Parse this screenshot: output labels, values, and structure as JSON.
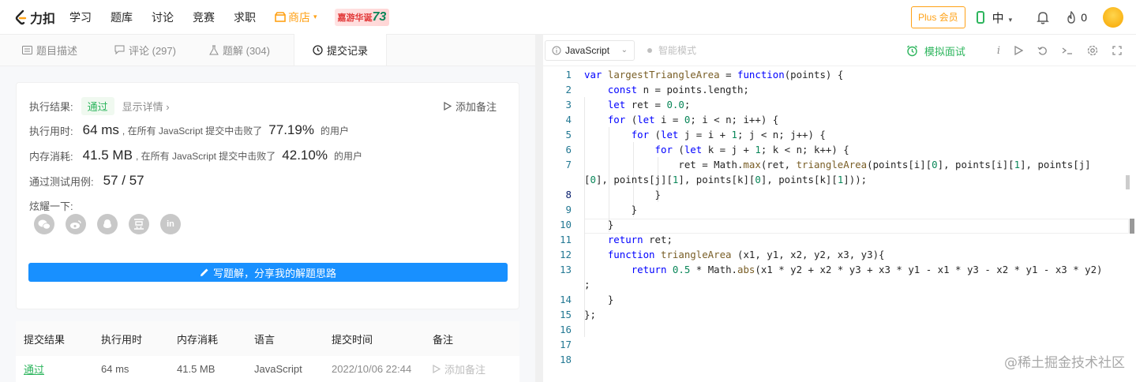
{
  "topnav": {
    "logo_text": "力扣",
    "items": [
      "学习",
      "题库",
      "讨论",
      "竞赛",
      "求职"
    ],
    "store": "商店",
    "promo_text": "嘉游华诞",
    "promo_num": "73",
    "plus": "Plus 会员",
    "lang": "中",
    "fire_count": "0"
  },
  "tabs": {
    "desc": "题目描述",
    "comments": "评论 (297)",
    "solutions": "题解 (304)",
    "submissions": "提交记录"
  },
  "result": {
    "exec_label": "执行结果:",
    "status": "通过",
    "detail": "显示详情 ›",
    "add_note": "添加备注",
    "runtime_label": "执行用时:",
    "runtime": "64 ms",
    "runtime_text": ", 在所有 JavaScript 提交中击败了",
    "runtime_pct": "77.19%",
    "users": "的用户",
    "memory_label": "内存消耗:",
    "memory": "41.5 MB",
    "memory_text": ", 在所有 JavaScript 提交中击败了",
    "memory_pct": "42.10%",
    "tests_label": "通过测试用例:",
    "tests": "57 / 57",
    "share_label": "炫耀一下:",
    "write_btn": "写题解，分享我的解题思路"
  },
  "table": {
    "headers": [
      "提交结果",
      "执行用时",
      "内存消耗",
      "语言",
      "提交时间",
      "备注"
    ],
    "rows": [
      {
        "result": "通过",
        "time": "64 ms",
        "memory": "41.5 MB",
        "lang": "JavaScript",
        "date": "2022/10/06 22:44",
        "note": "添加备注"
      }
    ]
  },
  "editor": {
    "language": "JavaScript",
    "smart_mode": "智能模式",
    "mock": "模拟面试",
    "watermark": "@稀土掘金技术社区",
    "line_numbers": [
      "1",
      "2",
      "3",
      "4",
      "5",
      "6",
      "7",
      "",
      "8",
      "9",
      "10",
      "11",
      "12",
      "13",
      "",
      "14",
      "15",
      "16",
      "17",
      "18"
    ]
  },
  "colors": {
    "accent_green": "#2db55d",
    "accent_orange": "#ffa116",
    "primary_blue": "#1890ff"
  }
}
